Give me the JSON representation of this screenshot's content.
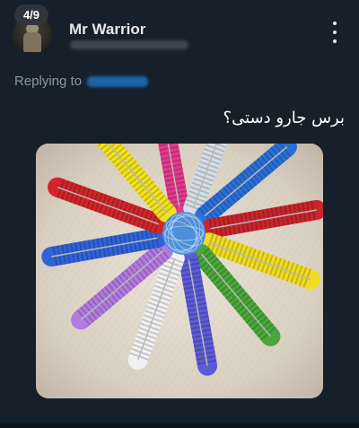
{
  "header": {
    "media_counter": "4/9",
    "display_name": "Mr Warrior"
  },
  "reply": {
    "label": "Replying to"
  },
  "tweet": {
    "text": "برس جارو دستی؟"
  },
  "media": {
    "alt": "Colorful bottle-brush cleaners arranged in a radial star around a blue ball of wire on a white fur rug",
    "brush_colors": [
      "#e23a8d",
      "#d6dfe8",
      "#2b6fd6",
      "#c9252c",
      "#f0dc22",
      "#4aa83a",
      "#5b5bd6",
      "#f1f1f1",
      "#b27be0",
      "#2f63d9",
      "#d0252a",
      "#f3e21f"
    ],
    "center_color": "#4d8fd8"
  },
  "colors": {
    "background": "#15202b",
    "text_primary": "#e7e9ea",
    "text_secondary": "#8b98a5",
    "accent": "#1d9bf0"
  }
}
